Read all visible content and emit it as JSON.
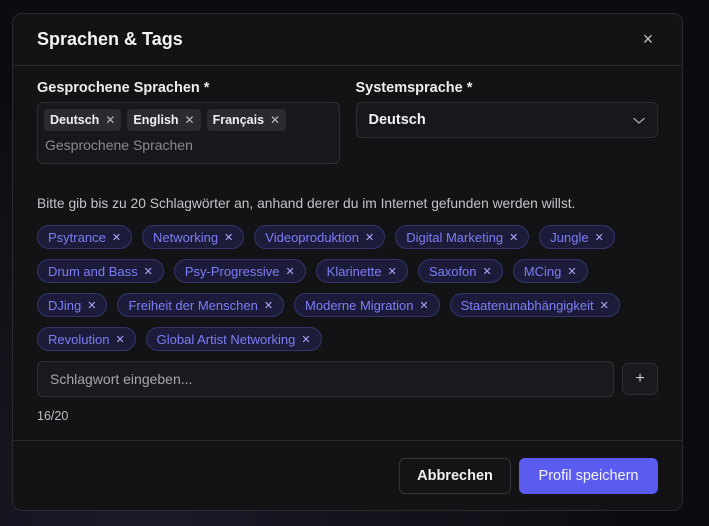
{
  "dialog": {
    "title": "Sprachen & Tags",
    "close_label": "×"
  },
  "spoken_languages": {
    "label": "Gesprochene Sprachen *",
    "selected": [
      "Deutsch",
      "English",
      "Français"
    ],
    "placeholder": "Gesprochene Sprachen"
  },
  "system_language": {
    "label": "Systemsprache *",
    "value": "Deutsch"
  },
  "tags": {
    "hint": "Bitte gib bis zu 20 Schlagwörter an, anhand derer du im Internet gefunden werden willst.",
    "items": [
      "Psytrance",
      "Networking",
      "Videoproduktion",
      "Digital Marketing",
      "Jungle",
      "Drum and Bass",
      "Psy-Progressive",
      "Klarinette",
      "Saxofon",
      "MCing",
      "DJing",
      "Freiheit der Menschen",
      "Moderne Migration",
      "Staatenunabhängigkeit",
      "Revolution",
      "Global Artist Networking"
    ],
    "input_placeholder": "Schlagwort eingeben...",
    "add_label": "+",
    "counter": "16/20"
  },
  "footer": {
    "cancel_label": "Abbrechen",
    "save_label": "Profil speichern"
  },
  "colors": {
    "accent": "#5b5bf0",
    "tag_text": "#7d7df5",
    "background": "#131316"
  }
}
